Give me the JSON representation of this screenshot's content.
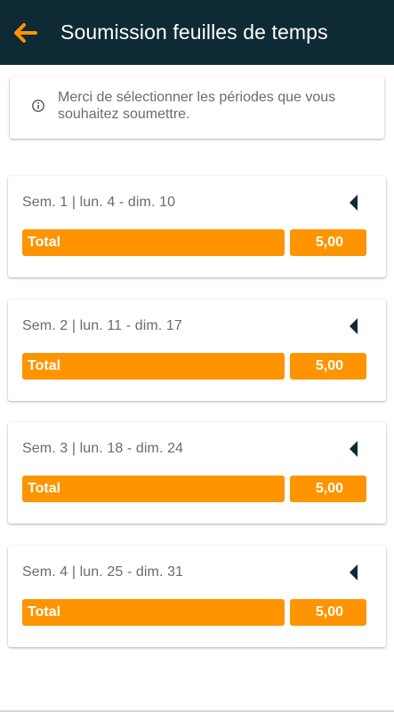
{
  "header": {
    "title": "Soumission feuilles de temps",
    "back_icon": "arrow-left-icon",
    "background": "#0e2a35",
    "accent": "#fd9400"
  },
  "info": {
    "icon": "info-icon",
    "text": "Merci de sélectionner les périodes que vous souhaitez soumettre."
  },
  "weeks": [
    {
      "label": "Sem. 1 | lun. 4 - dim. 10",
      "total_label": "Total",
      "total_value": "5,00"
    },
    {
      "label": "Sem. 2 | lun. 11 - dim. 17",
      "total_label": "Total",
      "total_value": "5,00"
    },
    {
      "label": "Sem. 3 | lun. 18 - dim. 24",
      "total_label": "Total",
      "total_value": "5,00"
    },
    {
      "label": "Sem. 4 | lun. 25 - dim. 31",
      "total_label": "Total",
      "total_value": "5,00"
    }
  ]
}
